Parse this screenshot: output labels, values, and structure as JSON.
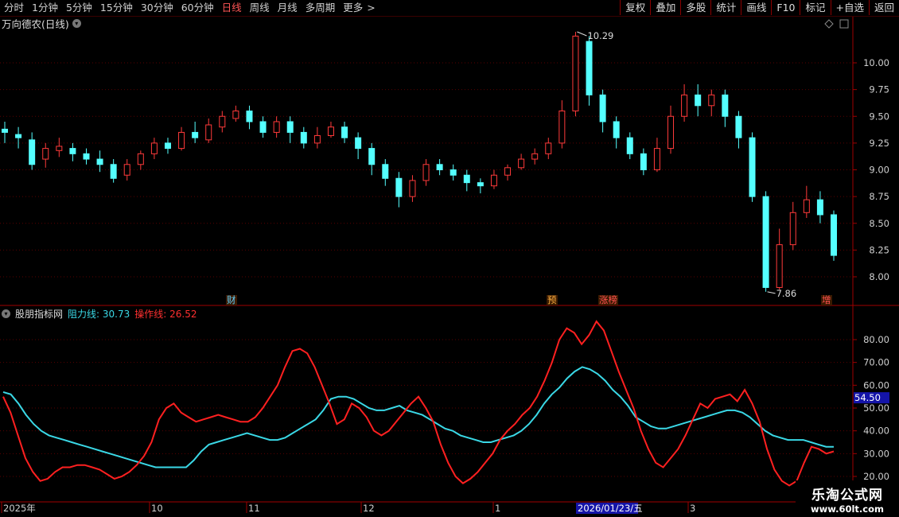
{
  "toolbar": {
    "periods": [
      "分时",
      "1分钟",
      "5分钟",
      "15分钟",
      "30分钟",
      "60分钟",
      "日线",
      "周线",
      "月线",
      "多周期",
      "更多"
    ],
    "active_period": "日线",
    "more_arrow": ">",
    "tools": [
      "复权",
      "叠加",
      "多股",
      "统计",
      "画线",
      "F10",
      "标记",
      "+自选",
      "返回"
    ]
  },
  "main_panel": {
    "title": "万向德农(日线)",
    "high_label": "10.29",
    "low_label": "7.86",
    "price_ticks": [
      "10.00",
      "9.75",
      "9.50",
      "9.25",
      "9.00",
      "8.75",
      "8.50",
      "8.25",
      "8.00"
    ],
    "event_badges": [
      {
        "text": "财",
        "color": "#5fd0ff"
      },
      {
        "text": "预",
        "color": "#ffb040"
      },
      {
        "text": "涨榜",
        "color": "#ff5050"
      },
      {
        "text": "增",
        "color": "#ff5050"
      }
    ]
  },
  "indicator_panel": {
    "name": "股朋指标网",
    "line1_label": "阻力线:",
    "line1_value": "30.73",
    "line2_label": "操作线:",
    "line2_value": "26.52",
    "ticks": [
      "80.00",
      "70.00",
      "60.00",
      "50.00",
      "40.00",
      "30.00",
      "20.00"
    ],
    "crosshair_value": "54.50"
  },
  "time_axis": {
    "labels": [
      "2025年",
      "10",
      "11",
      "12",
      "1",
      "2",
      "3"
    ],
    "crosshair_date": "2026/01/23/五"
  },
  "watermark": {
    "line1": "乐淘公式网",
    "line2": "www.60lt.com"
  },
  "colors": {
    "up": "#ff3a3a",
    "down": "#54ffff",
    "line_cyan": "#3ad8e6",
    "line_red": "#ff2020",
    "grid": "#5a0000",
    "frame": "#a00000"
  },
  "chart_data": {
    "type": "candlestick",
    "price_axis": {
      "min": 7.86,
      "max": 10.29
    },
    "candles": [
      [
        9.38,
        9.35,
        9.45,
        9.25
      ],
      [
        9.33,
        9.3,
        9.4,
        9.2
      ],
      [
        9.28,
        9.05,
        9.35,
        9.0
      ],
      [
        9.1,
        9.2,
        9.25,
        9.02
      ],
      [
        9.18,
        9.22,
        9.3,
        9.12
      ],
      [
        9.2,
        9.15,
        9.25,
        9.08
      ],
      [
        9.15,
        9.1,
        9.2,
        9.05
      ],
      [
        9.1,
        9.05,
        9.18,
        8.98
      ],
      [
        9.05,
        8.92,
        9.1,
        8.88
      ],
      [
        8.95,
        9.05,
        9.1,
        8.9
      ],
      [
        9.05,
        9.15,
        9.18,
        9.0
      ],
      [
        9.15,
        9.25,
        9.3,
        9.1
      ],
      [
        9.25,
        9.2,
        9.3,
        9.15
      ],
      [
        9.2,
        9.35,
        9.4,
        9.18
      ],
      [
        9.35,
        9.3,
        9.45,
        9.25
      ],
      [
        9.28,
        9.42,
        9.48,
        9.25
      ],
      [
        9.4,
        9.5,
        9.55,
        9.35
      ],
      [
        9.48,
        9.55,
        9.6,
        9.45
      ],
      [
        9.55,
        9.45,
        9.6,
        9.38
      ],
      [
        9.45,
        9.35,
        9.5,
        9.3
      ],
      [
        9.35,
        9.45,
        9.5,
        9.3
      ],
      [
        9.45,
        9.35,
        9.5,
        9.25
      ],
      [
        9.35,
        9.25,
        9.4,
        9.2
      ],
      [
        9.25,
        9.32,
        9.4,
        9.2
      ],
      [
        9.32,
        9.4,
        9.45,
        9.3
      ],
      [
        9.4,
        9.3,
        9.45,
        9.25
      ],
      [
        9.3,
        9.2,
        9.35,
        9.1
      ],
      [
        9.2,
        9.05,
        9.25,
        8.95
      ],
      [
        9.05,
        8.92,
        9.1,
        8.85
      ],
      [
        8.92,
        8.75,
        8.98,
        8.65
      ],
      [
        8.75,
        8.9,
        8.95,
        8.7
      ],
      [
        8.9,
        9.05,
        9.1,
        8.85
      ],
      [
        9.05,
        9.0,
        9.1,
        8.95
      ],
      [
        9.0,
        8.95,
        9.05,
        8.9
      ],
      [
        8.95,
        8.88,
        9.0,
        8.8
      ],
      [
        8.88,
        8.85,
        8.92,
        8.78
      ],
      [
        8.85,
        8.95,
        9.0,
        8.82
      ],
      [
        8.95,
        9.02,
        9.05,
        8.9
      ],
      [
        9.02,
        9.1,
        9.15,
        9.0
      ],
      [
        9.1,
        9.15,
        9.2,
        9.05
      ],
      [
        9.15,
        9.25,
        9.3,
        9.1
      ],
      [
        9.25,
        9.55,
        9.65,
        9.2
      ],
      [
        9.55,
        10.25,
        10.29,
        9.5
      ],
      [
        10.2,
        9.7,
        10.25,
        9.6
      ],
      [
        9.7,
        9.45,
        9.75,
        9.35
      ],
      [
        9.45,
        9.3,
        9.5,
        9.2
      ],
      [
        9.3,
        9.15,
        9.35,
        9.1
      ],
      [
        9.15,
        9.0,
        9.2,
        8.95
      ],
      [
        9.0,
        9.2,
        9.3,
        8.98
      ],
      [
        9.2,
        9.5,
        9.6,
        9.15
      ],
      [
        9.5,
        9.7,
        9.8,
        9.45
      ],
      [
        9.7,
        9.6,
        9.8,
        9.5
      ],
      [
        9.6,
        9.7,
        9.75,
        9.5
      ],
      [
        9.7,
        9.5,
        9.75,
        9.4
      ],
      [
        9.5,
        9.3,
        9.55,
        9.2
      ],
      [
        9.3,
        8.75,
        9.35,
        8.7
      ],
      [
        8.75,
        7.9,
        8.8,
        7.86
      ],
      [
        7.9,
        8.3,
        8.45,
        7.88
      ],
      [
        8.3,
        8.6,
        8.7,
        8.25
      ],
      [
        8.6,
        8.72,
        8.85,
        8.55
      ],
      [
        8.72,
        8.58,
        8.8,
        8.5
      ],
      [
        8.58,
        8.2,
        8.62,
        8.15
      ]
    ]
  }
}
